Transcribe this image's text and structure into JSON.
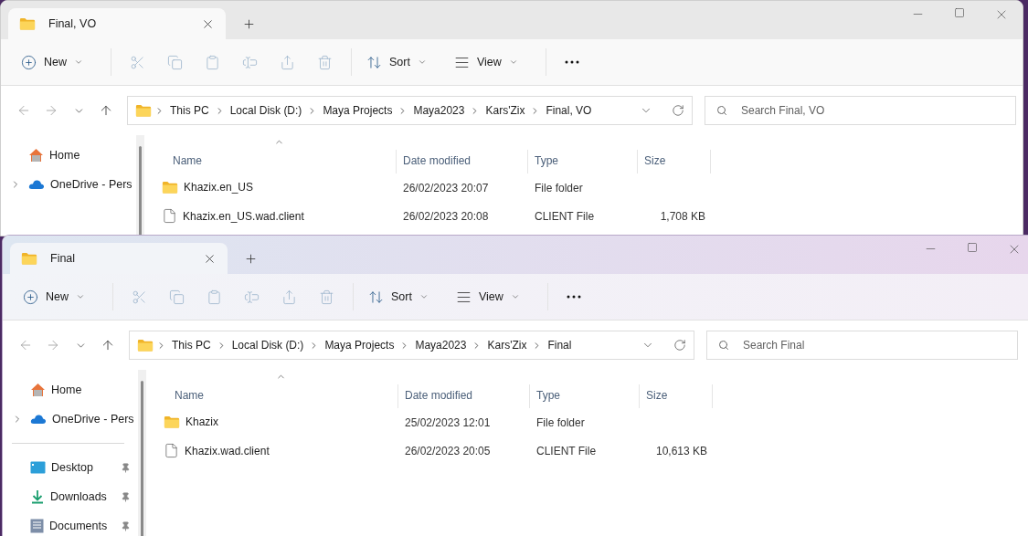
{
  "windows": [
    {
      "active": false,
      "tabs": [
        {
          "label": "Final, VO",
          "selected": true
        }
      ],
      "toolbar": [
        {
          "kind": "new",
          "label": "New",
          "disabled": false
        },
        {
          "kind": "cut",
          "disabled": true
        },
        {
          "kind": "copy",
          "disabled": true
        },
        {
          "kind": "paste",
          "disabled": true
        },
        {
          "kind": "rename",
          "disabled": true
        },
        {
          "kind": "share",
          "disabled": true
        },
        {
          "kind": "delete",
          "disabled": true
        },
        {
          "kind": "sort",
          "label": "Sort",
          "disabled": false
        },
        {
          "kind": "view",
          "label": "View",
          "disabled": false
        },
        {
          "kind": "more"
        }
      ],
      "breadcrumb": [
        "This PC",
        "Local Disk (D:)",
        "Maya Projects",
        "Maya2023",
        "Kars'Zix",
        "Final, VO"
      ],
      "search": {
        "placeholder": "Search Final, VO"
      },
      "sidebar": [
        {
          "kind": "home",
          "label": "Home",
          "expandable": false,
          "pinned": false
        },
        {
          "kind": "cloud",
          "label": "OneDrive - Pers",
          "expandable": true,
          "pinned": false
        }
      ],
      "columns": [
        "Name",
        "Date modified",
        "Type",
        "Size"
      ],
      "rows": [
        {
          "kind": "folder",
          "name": "Khazix.en_US",
          "date": "26/02/2023 20:07",
          "type": "File folder"
        },
        {
          "kind": "file",
          "name": "Khazix.en_US.wad.client",
          "date": "26/02/2023 20:08",
          "type": "CLIENT File",
          "size": "1,708 KB"
        }
      ]
    },
    {
      "active": true,
      "tabs": [
        {
          "label": "Final",
          "selected": true
        }
      ],
      "toolbar": [
        {
          "kind": "new",
          "label": "New",
          "disabled": false
        },
        {
          "kind": "cut",
          "disabled": true
        },
        {
          "kind": "copy",
          "disabled": true
        },
        {
          "kind": "paste",
          "disabled": true
        },
        {
          "kind": "rename",
          "disabled": true
        },
        {
          "kind": "share",
          "disabled": true
        },
        {
          "kind": "delete",
          "disabled": true
        },
        {
          "kind": "sort",
          "label": "Sort",
          "disabled": false
        },
        {
          "kind": "view",
          "label": "View",
          "disabled": false
        },
        {
          "kind": "more"
        }
      ],
      "breadcrumb": [
        "This PC",
        "Local Disk (D:)",
        "Maya Projects",
        "Maya2023",
        "Kars'Zix",
        "Final"
      ],
      "search": {
        "placeholder": "Search Final"
      },
      "sidebar": [
        {
          "kind": "home",
          "label": "Home",
          "expandable": false,
          "pinned": false
        },
        {
          "kind": "cloud",
          "label": "OneDrive - Pers",
          "expandable": true,
          "pinned": false
        },
        {
          "kind": "separator"
        },
        {
          "kind": "desktop",
          "label": "Desktop",
          "expandable": false,
          "pinned": true
        },
        {
          "kind": "downloads",
          "label": "Downloads",
          "expandable": false,
          "pinned": true
        },
        {
          "kind": "documents",
          "label": "Documents",
          "expandable": false,
          "pinned": true
        }
      ],
      "columns": [
        "Name",
        "Date modified",
        "Type",
        "Size"
      ],
      "rows": [
        {
          "kind": "folder",
          "name": "Khazix",
          "date": "25/02/2023 12:01",
          "type": "File folder"
        },
        {
          "kind": "file",
          "name": "Khazix.wad.client",
          "date": "26/02/2023 20:05",
          "type": "CLIENT File",
          "size": "10,613 KB"
        }
      ]
    }
  ]
}
